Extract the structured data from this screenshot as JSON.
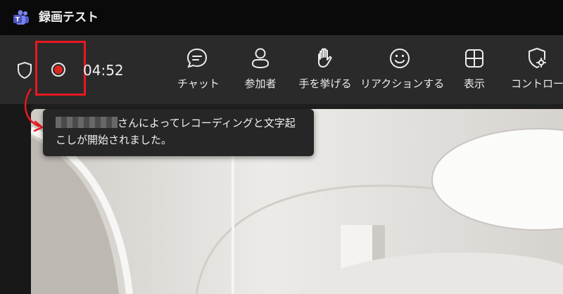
{
  "window": {
    "title": "録画テスト"
  },
  "toolbar": {
    "timer": "04:52",
    "items": [
      {
        "label": "チャット",
        "icon": "chat-icon"
      },
      {
        "label": "参加者",
        "icon": "people-icon"
      },
      {
        "label": "手を挙げる",
        "icon": "raise-hand-icon"
      },
      {
        "label": "リアクションする",
        "icon": "reaction-icon"
      },
      {
        "label": "表示",
        "icon": "view-icon"
      },
      {
        "label": "コントロール",
        "icon": "control-icon"
      }
    ]
  },
  "notification": {
    "line1": "さんによってレコーディングと文字起",
    "line2": "こしが開始されました。"
  },
  "colors": {
    "accent": "#e8191f",
    "recording": "#d9281e"
  }
}
